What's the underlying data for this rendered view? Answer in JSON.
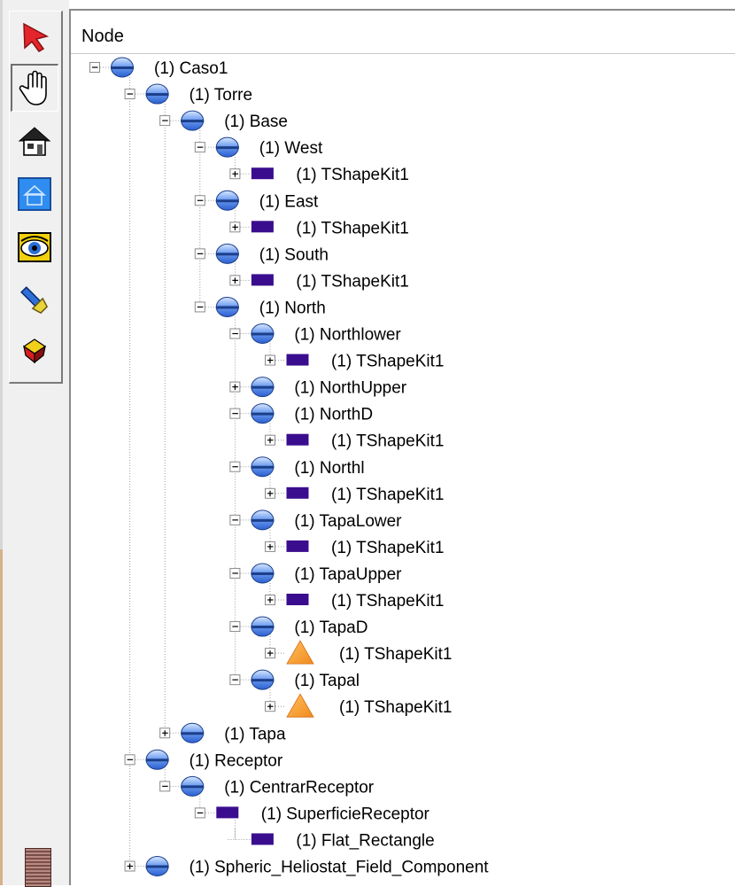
{
  "header": {
    "column_label": "Node"
  },
  "toolbar": {
    "tools": [
      {
        "name": "select-arrow-icon",
        "active": false
      },
      {
        "name": "hand-pan-icon",
        "active": true
      },
      {
        "name": "home-view-icon",
        "active": false
      },
      {
        "name": "view-all-icon",
        "active": false
      },
      {
        "name": "eye-seek-icon",
        "active": false
      },
      {
        "name": "flashlight-icon",
        "active": false
      },
      {
        "name": "shape-cube-icon",
        "active": false
      }
    ]
  },
  "tree": [
    {
      "label": "(1) Caso1",
      "icon": "sphere",
      "expander": "minus"
    },
    {
      "label": "(1) Torre",
      "icon": "sphere",
      "expander": "minus"
    },
    {
      "label": "(1) Base",
      "icon": "sphere",
      "expander": "minus"
    },
    {
      "label": "(1) West",
      "icon": "sphere",
      "expander": "minus"
    },
    {
      "label": "(1) TShapeKit1",
      "icon": "rect",
      "expander": "plus"
    },
    {
      "label": "(1) East",
      "icon": "sphere",
      "expander": "minus"
    },
    {
      "label": "(1) TShapeKit1",
      "icon": "rect",
      "expander": "plus"
    },
    {
      "label": "(1) South",
      "icon": "sphere",
      "expander": "minus"
    },
    {
      "label": "(1) TShapeKit1",
      "icon": "rect",
      "expander": "plus"
    },
    {
      "label": "(1) North",
      "icon": "sphere",
      "expander": "minus"
    },
    {
      "label": "(1) Northlower",
      "icon": "sphere",
      "expander": "minus"
    },
    {
      "label": "(1) TShapeKit1",
      "icon": "rect",
      "expander": "plus"
    },
    {
      "label": "(1) NorthUpper",
      "icon": "sphere",
      "expander": "plus"
    },
    {
      "label": "(1) NorthD",
      "icon": "sphere",
      "expander": "minus"
    },
    {
      "label": "(1) TShapeKit1",
      "icon": "rect",
      "expander": "plus"
    },
    {
      "label": "(1) Northl",
      "icon": "sphere",
      "expander": "minus"
    },
    {
      "label": "(1) TShapeKit1",
      "icon": "rect",
      "expander": "plus"
    },
    {
      "label": "(1) TapaLower",
      "icon": "sphere",
      "expander": "minus"
    },
    {
      "label": "(1) TShapeKit1",
      "icon": "rect",
      "expander": "plus"
    },
    {
      "label": "(1) TapaUpper",
      "icon": "sphere",
      "expander": "minus"
    },
    {
      "label": "(1) TShapeKit1",
      "icon": "rect",
      "expander": "plus"
    },
    {
      "label": "(1) TapaD",
      "icon": "sphere",
      "expander": "minus"
    },
    {
      "label": "(1) TShapeKit1",
      "icon": "triangle",
      "expander": "plus"
    },
    {
      "label": "(1) Tapal",
      "icon": "sphere",
      "expander": "minus"
    },
    {
      "label": "(1) TShapeKit1",
      "icon": "triangle",
      "expander": "plus"
    },
    {
      "label": "(1) Tapa",
      "icon": "sphere",
      "expander": "plus"
    },
    {
      "label": "(1) Receptor",
      "icon": "sphere",
      "expander": "minus"
    },
    {
      "label": "(1) CentrarReceptor",
      "icon": "sphere",
      "expander": "minus"
    },
    {
      "label": "(1) SuperficieReceptor",
      "icon": "rect",
      "expander": "minus"
    },
    {
      "label": "(1) Flat_Rectangle",
      "icon": "rect",
      "expander": "none"
    },
    {
      "label": "(1) Spheric_Heliostat_Field_Component",
      "icon": "sphere",
      "expander": "plus"
    }
  ],
  "colors": {
    "rect_icon": "#3a0d8e",
    "triangle_icon": "#f08a1c",
    "sphere_icon": "#2a5fd0"
  }
}
